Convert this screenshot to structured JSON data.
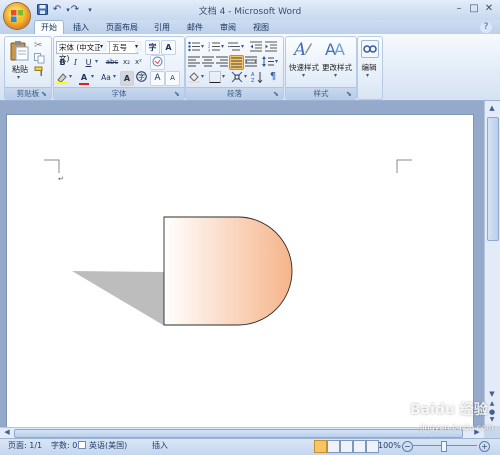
{
  "title": "文档 4 - Microsoft Word",
  "tabs": [
    "开始",
    "插入",
    "页面布局",
    "引用",
    "邮件",
    "审阅",
    "视图"
  ],
  "clipboard": {
    "paste": "粘贴",
    "label": "剪贴板"
  },
  "font": {
    "name": "宋体 (中文正文)",
    "size": "五号",
    "label": "字体",
    "bold": "B",
    "italic": "I",
    "underline": "U",
    "strike": "abc",
    "sub": "x₂",
    "sup": "x²",
    "grow": "A",
    "shrink": "A",
    "aa": "Aa",
    "a_char": "A",
    "a_circle": "字",
    "a_box": "A",
    "a_big": "A",
    "clear": "A"
  },
  "paragraph": {
    "label": "段落"
  },
  "styles": {
    "quick": "快速样式",
    "change": "更改样式",
    "label": "样式"
  },
  "editing": {
    "label": "编辑"
  },
  "status": {
    "page": "页面: 1/1",
    "words": "字数: 0",
    "lang": "英语(美国)",
    "mode": "插入",
    "zoom": "100%"
  },
  "page_marks": {
    "para": "↵"
  },
  "watermark": "Baidu 经验",
  "watermark_url": "jingyan.baidu.com",
  "shape": {
    "fill_start": "#ffffff",
    "fill_end": "#f6b48a",
    "shadow": "#bdbdbd"
  }
}
